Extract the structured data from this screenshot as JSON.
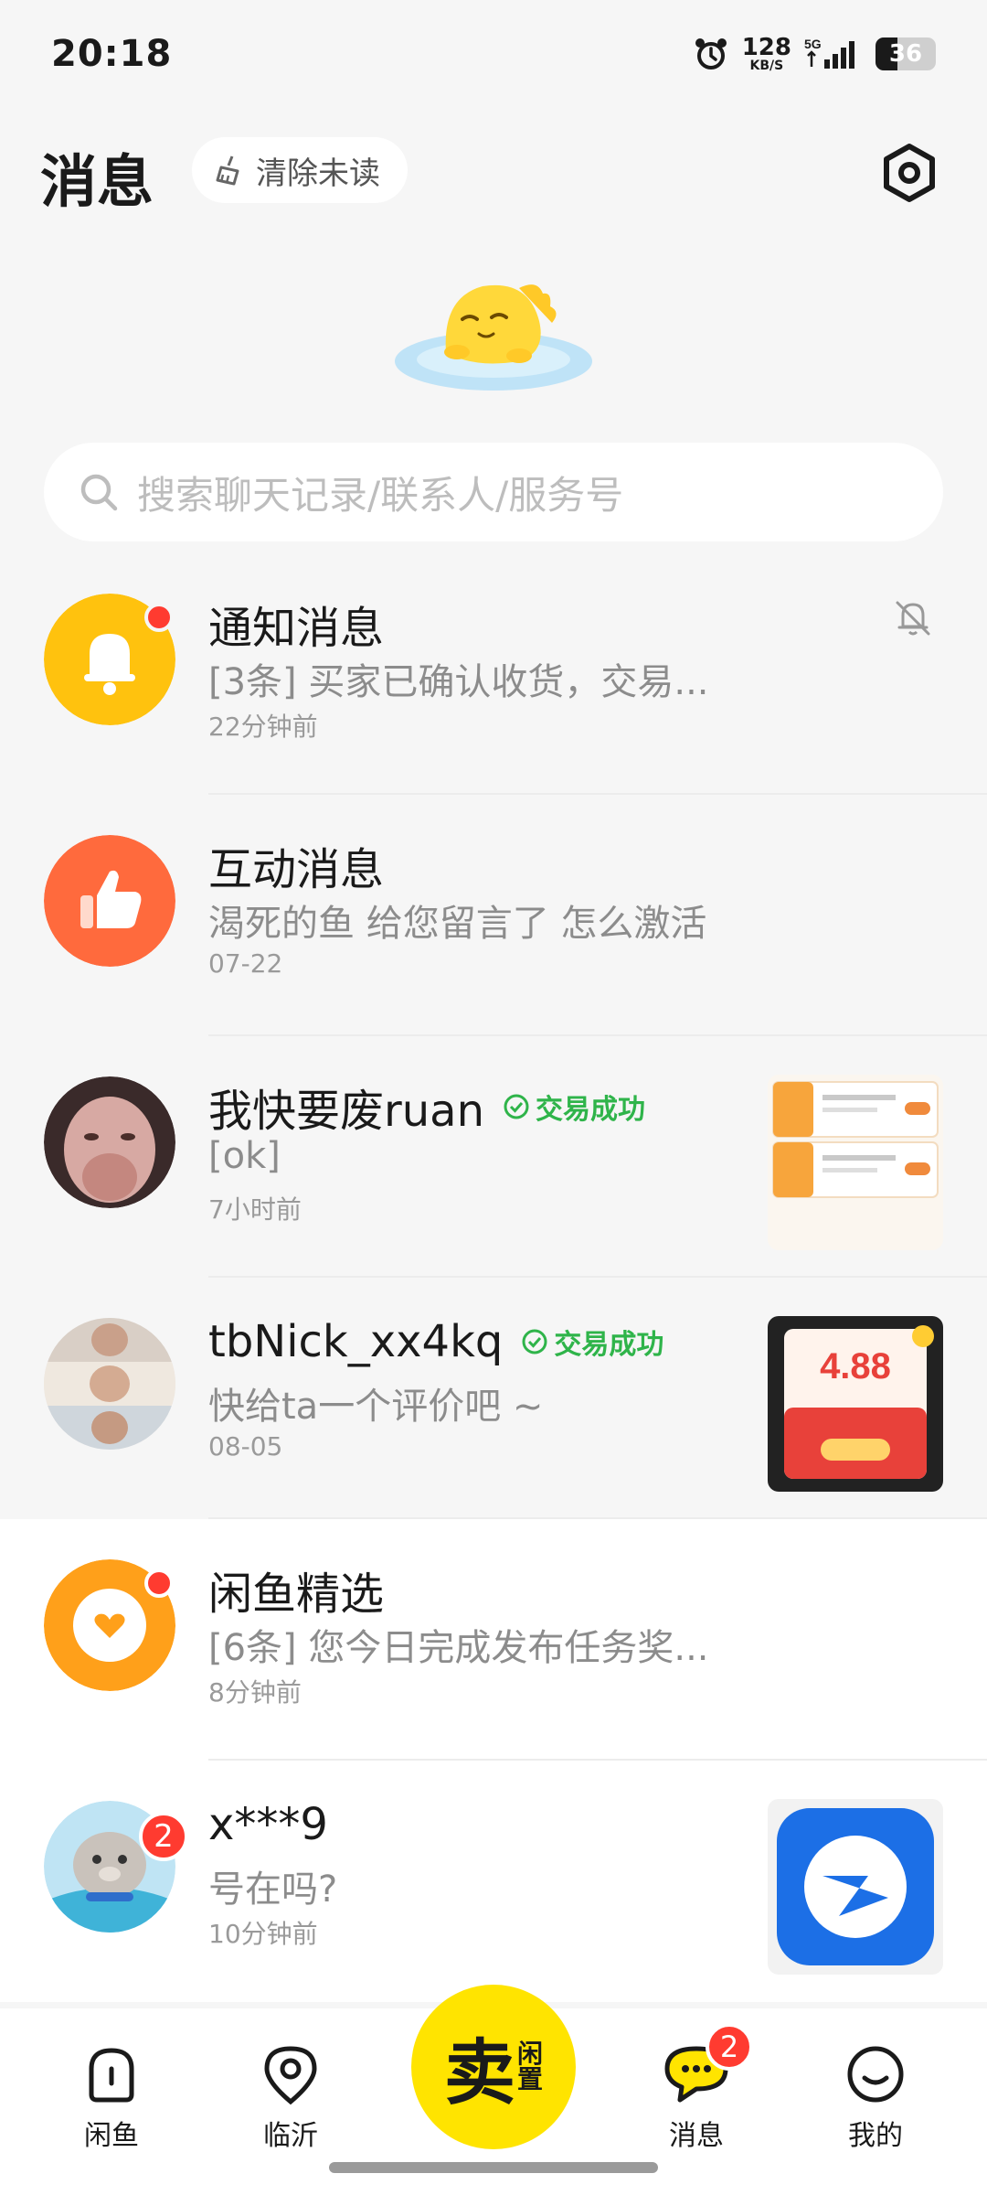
{
  "status_bar": {
    "time": "20:18",
    "net_speed": "128",
    "net_unit": "KB/S",
    "signal_label": "5G",
    "battery": "36",
    "battery_level": 0.36
  },
  "header": {
    "title": "消息",
    "clear_unread": "清除未读"
  },
  "search": {
    "placeholder": "搜索聊天记录/联系人/服务号"
  },
  "conversations": [
    {
      "name": "通知消息",
      "preview": "[3条] 买家已确认收货，交易...",
      "time": "22分钟前",
      "unread_dot": true,
      "muted": true
    },
    {
      "name": "互动消息",
      "preview": "渴死的鱼 给您留言了 怎么激活",
      "time": "07-22"
    },
    {
      "name": "我快要废ruan",
      "tag": "交易成功",
      "preview": "[ok]",
      "time": "7小时前"
    },
    {
      "name": "tbNick_xx4kq",
      "tag": "交易成功",
      "preview": "快给ta一个评价吧 ~",
      "time": "08-05",
      "thumb_amount": "4.88"
    },
    {
      "name": "闲鱼精选",
      "preview": "[6条] 您今日完成发布任务奖...",
      "time": "8分钟前",
      "unread_dot": true
    },
    {
      "name": "x***9",
      "preview": "号在吗?",
      "time": "10分钟前",
      "badge": "2"
    }
  ],
  "bottom_nav": {
    "home": "闲鱼",
    "nearby": "临沂",
    "sell_main": "卖",
    "sell_sub1": "闲",
    "sell_sub2": "置",
    "messages": "消息",
    "messages_badge": "2",
    "mine": "我的"
  },
  "colors": {
    "accent_yellow": "#ffe400",
    "badge_red": "#ff3b30",
    "success_green": "#2fb44a"
  }
}
